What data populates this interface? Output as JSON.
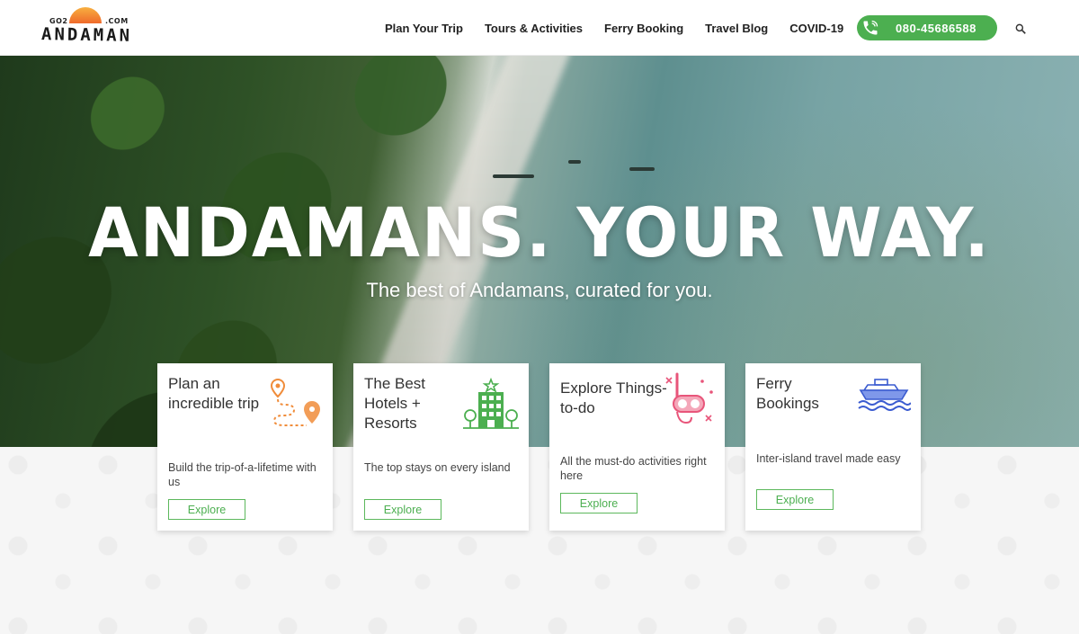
{
  "logo": {
    "top_left": "GO2",
    "top_right": ".COM",
    "word": "ANDAMAN"
  },
  "nav": [
    {
      "label": "Plan Your Trip"
    },
    {
      "label": "Tours & Activities"
    },
    {
      "label": "Ferry Booking"
    },
    {
      "label": "Travel Blog"
    },
    {
      "label": "COVID-19"
    }
  ],
  "phone": {
    "number": "080-45686588"
  },
  "hero": {
    "title": "ANDAMANS. YOUR WAY.",
    "subtitle": "The best of Andamans, curated for you."
  },
  "cards": [
    {
      "title": "Plan an incredible trip",
      "desc": "Build the trip-of-a-lifetime with us",
      "button": "Explore",
      "icon": "map-route-icon"
    },
    {
      "title": "The Best Hotels + Resorts",
      "desc": "The top stays on every island",
      "button": "Explore",
      "icon": "hotel-icon"
    },
    {
      "title": "Explore Things-to-do",
      "desc": "All the must-do activities right here",
      "button": "Explore",
      "icon": "snorkel-icon"
    },
    {
      "title": "Ferry Bookings",
      "desc": "Inter-island travel made easy",
      "button": "Explore",
      "icon": "ferry-icon"
    }
  ],
  "colors": {
    "accent_green": "#4caf50",
    "logo_orange": "#ef6a2b",
    "icon_orange": "#f08c3a",
    "icon_pink": "#e8557a",
    "icon_blue": "#3a5bd0"
  }
}
